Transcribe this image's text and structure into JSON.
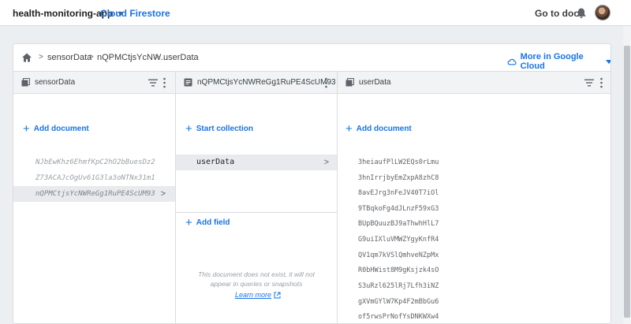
{
  "topbar": {
    "project_name": "health-monitoring-app",
    "product_name": "Cloud Firestore",
    "docs_link": "Go to docs"
  },
  "breadcrumb": {
    "items": [
      "sensorData",
      "nQPMCtjsYcNW...",
      "userData"
    ],
    "more_in_cloud": "More in Google Cloud"
  },
  "col1": {
    "title": "sensorData",
    "add_label": "Add document",
    "documents": [
      "NJbEwKhz6EhmfKpC2hO2bBuesDz2",
      "Z73ACAJcOgUv61G3la3oNTNx31m1",
      "nQPMCtjsYcNWReGg1RuPE4ScUM93"
    ]
  },
  "col2": {
    "title": "nQPMCtjsYcNWReGg1RuPE4ScUM93",
    "start_collection_label": "Start collection",
    "collections": [
      "userData"
    ],
    "add_field_label": "Add field",
    "empty_message": "This document does not exist, it will not appear in queries or snapshots",
    "learn_more": "Learn more"
  },
  "col3": {
    "title": "userData",
    "add_label": "Add document",
    "documents": [
      "3heiaufPlLW2EQs0rLmu",
      "3hnIrrjbyEmZxpA8zhC8",
      "8avEJrg3nFeJV40T7iOl",
      "9TBqkoFg4dJLnzF59xG3",
      "BUpBQuuzBJ9aThwhHlL7",
      "G9uiIXluVMWZYgyKnfR4",
      "QV1qm7kVSlQmhveNZpMx",
      "R0bHWist8M9gKsjzk4sO",
      "S3uRzl625lRj7Lfh3iNZ",
      "gXVmGYlW7Kp4F2mBbGu6",
      "of5rwsPrNofYsDNKWXw4"
    ]
  },
  "colors": {
    "accent": "#1a73e8",
    "selected_row": "#e8eaed",
    "header_bg": "#f1f3f4",
    "page_bg": "#eceff1"
  }
}
